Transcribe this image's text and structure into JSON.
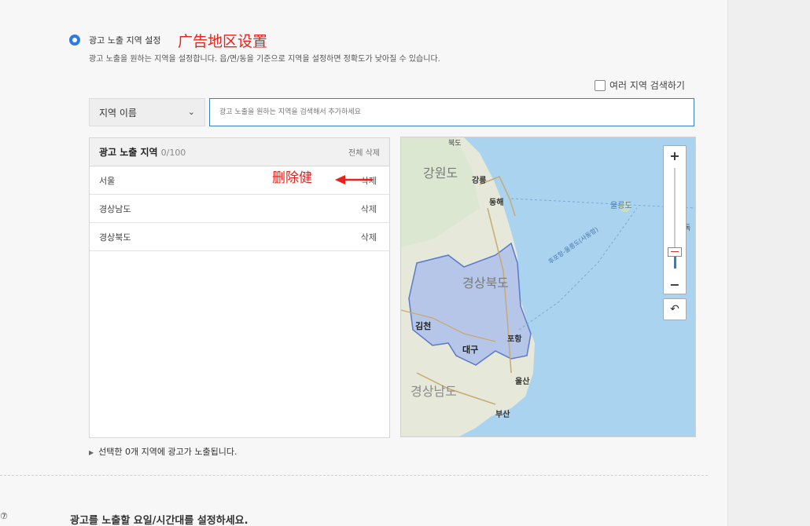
{
  "section": {
    "title": "광고 노출 지역 설정",
    "annotation": "广告地区设置",
    "description": "광고 노출을 원하는 지역을 설정합니다. 읍/면/동을 기준으로 지역을 설정하면 정확도가 낮아질 수 있습니다."
  },
  "multi_search": {
    "label": "여러 지역 검색하기"
  },
  "select": {
    "value": "지역 이름"
  },
  "search": {
    "placeholder": "광고 노출을 원하는 지역을 검색해서 추가하세요"
  },
  "list": {
    "header": "광고 노출 지역",
    "count": "0/100",
    "clear_all": "전체 삭제",
    "items": [
      {
        "name": "서울",
        "delete": "삭제"
      },
      {
        "name": "경상남도",
        "delete": "삭제"
      },
      {
        "name": "경상북도",
        "delete": "삭제"
      }
    ],
    "delete_annotation": "删除健"
  },
  "footer": {
    "text": "선택한 0개 지역에 광고가 노출됩니다."
  },
  "map": {
    "labels": {
      "gangwon": "강원도",
      "gangneung": "강릉",
      "donghae": "동해",
      "ulleungdo": "울릉도",
      "route": "후포항-울릉도(사동항)",
      "gyeongbuk": "경상북도",
      "gimcheon": "김천",
      "daegu": "대구",
      "pohang": "포항",
      "gyeongnam": "경상남도",
      "ulsan": "울산",
      "busan": "부산",
      "top": "북도",
      "right": "독"
    },
    "zoom_in": "+",
    "zoom_out": "−",
    "reset": "↶"
  },
  "next_section": {
    "help": "⑦",
    "label": "광고를 노출할 요일/시간대를 설정하세요."
  }
}
